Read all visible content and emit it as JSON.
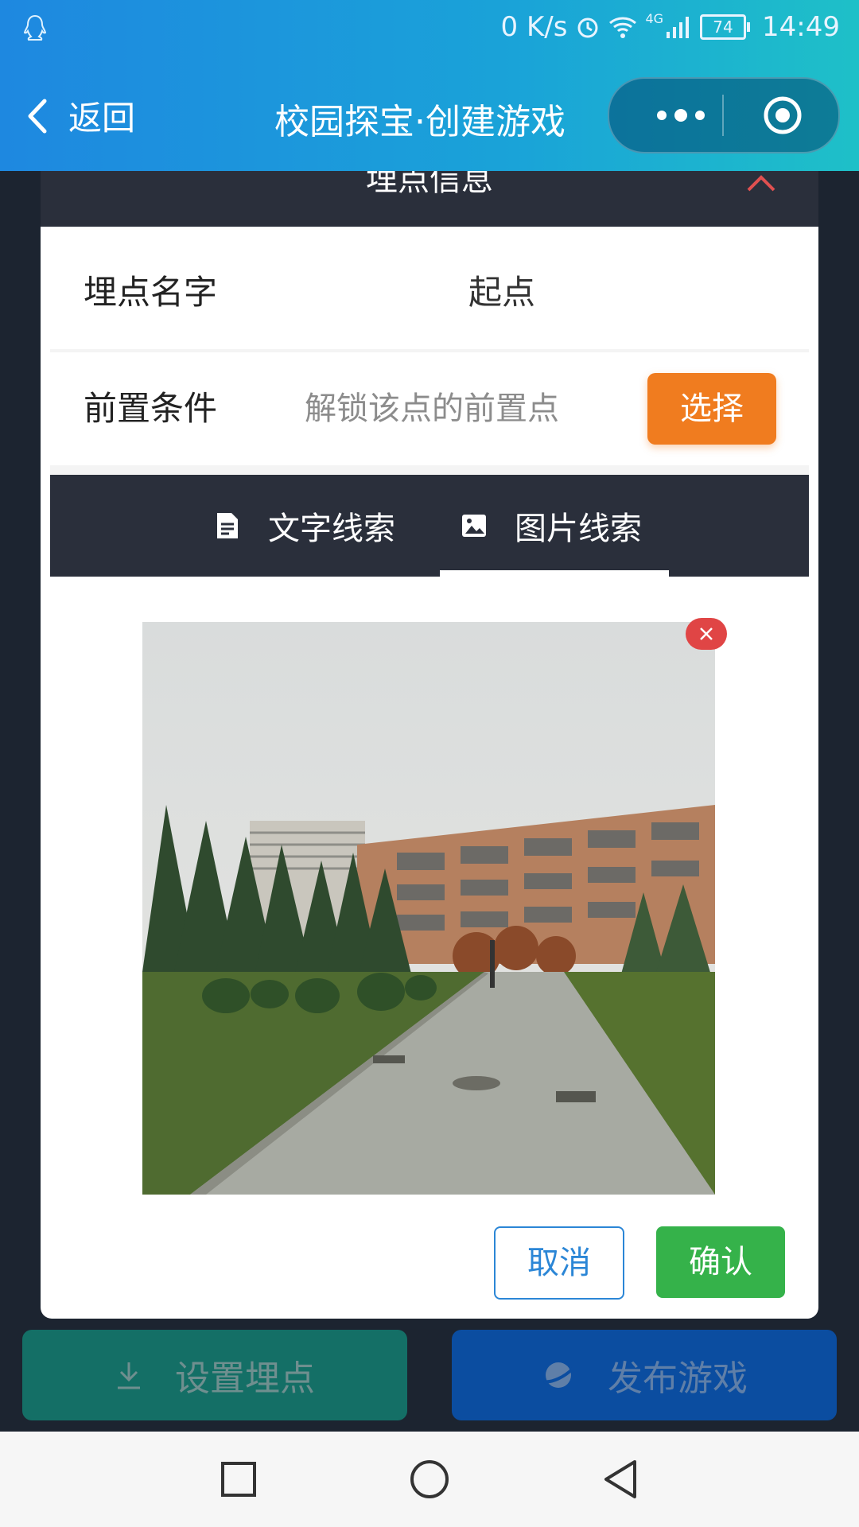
{
  "status_bar": {
    "network_speed": "0 K/s",
    "network_type": "4G",
    "battery": "74",
    "time": "14:49",
    "icons": [
      "qq-icon",
      "alarm-icon",
      "wifi-icon",
      "signal-icon",
      "battery-icon"
    ]
  },
  "titlebar": {
    "back_label": "返回",
    "title": "校园探宝·创建游戏"
  },
  "modal": {
    "title": "埋点信息",
    "name_row": {
      "label": "埋点名字",
      "value": "起点"
    },
    "precondition_row": {
      "label": "前置条件",
      "placeholder": "解锁该点的前置点",
      "button": "选择"
    },
    "tabs": [
      {
        "label": "文字线索",
        "icon": "document-icon",
        "active": false
      },
      {
        "label": "图片线索",
        "icon": "image-icon",
        "active": true
      }
    ],
    "cancel_label": "取消",
    "confirm_label": "确认"
  },
  "bottom_actions": {
    "set_point_label": "设置埋点",
    "publish_label": "发布游戏"
  },
  "colors": {
    "header_gradient_start": "#1e88e0",
    "header_gradient_end": "#1ec0c8",
    "select_button": "#f07c1f",
    "confirm_button": "#35b24a",
    "cancel_border": "#2b86d6",
    "delete_badge": "#e04545",
    "tab_bar": "#2a2f3b"
  }
}
